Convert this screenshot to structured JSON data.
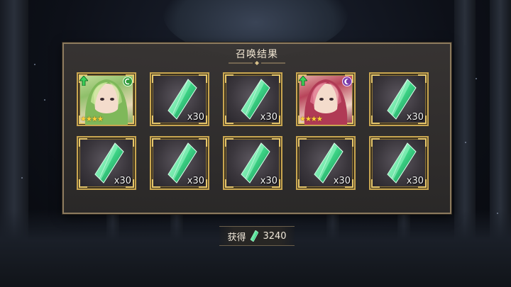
{
  "panel": {
    "title": "召唤结果"
  },
  "results": [
    {
      "kind": "character",
      "theme": "green",
      "element_icon": "nature-element-icon",
      "stars": "★★★★",
      "quantity": ""
    },
    {
      "kind": "crystal",
      "quantity": "x30"
    },
    {
      "kind": "crystal",
      "quantity": "x30"
    },
    {
      "kind": "character",
      "theme": "red",
      "element_icon": "moon-element-icon",
      "stars": "★★★★",
      "quantity": ""
    },
    {
      "kind": "crystal",
      "quantity": "x30"
    },
    {
      "kind": "crystal",
      "quantity": "x30"
    },
    {
      "kind": "crystal",
      "quantity": "x30"
    },
    {
      "kind": "crystal",
      "quantity": "x30"
    },
    {
      "kind": "crystal",
      "quantity": "x30"
    },
    {
      "kind": "crystal",
      "quantity": "x30"
    }
  ],
  "footer": {
    "label": "获得",
    "amount": "3240",
    "icon": "crystal-icon"
  },
  "colors": {
    "frame_gold": "#c9a650",
    "crystal_green": "#3fd98a",
    "panel_border": "#8c7a5e"
  }
}
